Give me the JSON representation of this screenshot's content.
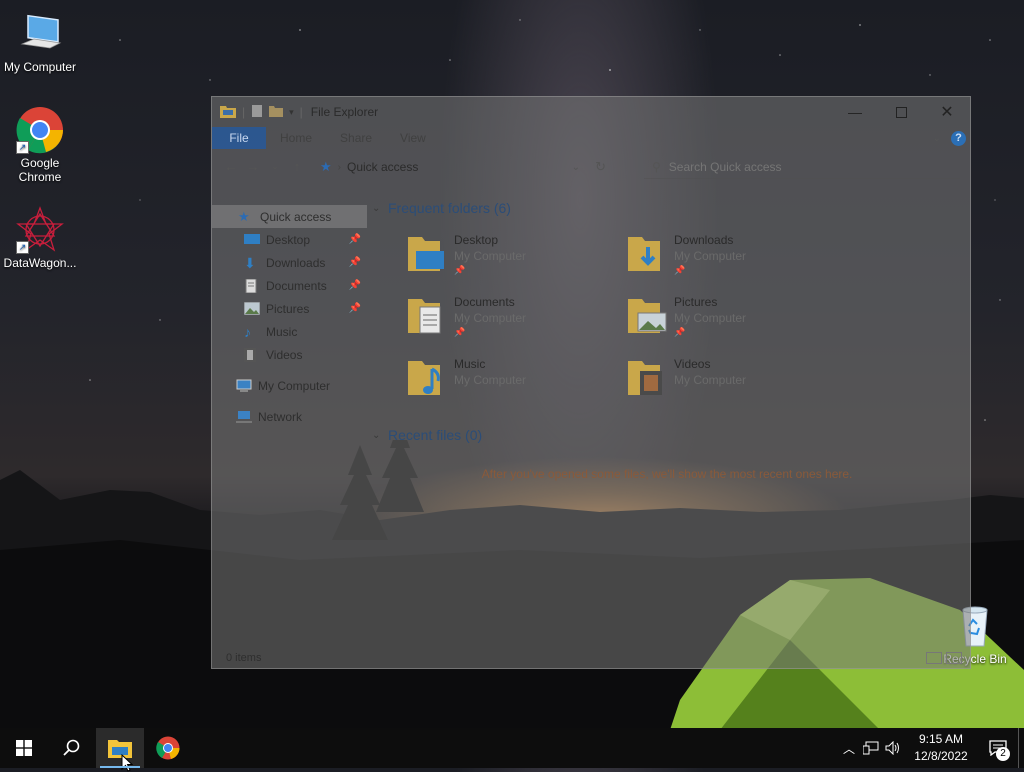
{
  "desktop": {
    "icons": [
      {
        "label": "My Computer"
      },
      {
        "label": "Google\nChrome"
      },
      {
        "label": "DataWagon..."
      },
      {
        "label": "Recycle Bin"
      }
    ]
  },
  "explorer": {
    "title": "File Explorer",
    "ribbon_tabs": [
      "File",
      "Home",
      "Share",
      "View"
    ],
    "address": "Quick access",
    "search_placeholder": "Search Quick access",
    "nav": [
      {
        "label": "Quick access",
        "icon": "star-icon"
      },
      {
        "label": "Desktop",
        "icon": "desktop-folder-icon",
        "pinned": true
      },
      {
        "label": "Downloads",
        "icon": "download-icon",
        "pinned": true
      },
      {
        "label": "Documents",
        "icon": "documents-icon",
        "pinned": true
      },
      {
        "label": "Pictures",
        "icon": "pictures-icon",
        "pinned": true
      },
      {
        "label": "Music",
        "icon": "music-icon"
      },
      {
        "label": "Videos",
        "icon": "videos-icon"
      },
      {
        "label": "My Computer",
        "icon": "computer-icon"
      },
      {
        "label": "Network",
        "icon": "network-icon"
      }
    ],
    "frequent_header": "Frequent folders (6)",
    "folders": [
      {
        "name": "Desktop",
        "location": "My Computer"
      },
      {
        "name": "Downloads",
        "location": "My Computer"
      },
      {
        "name": "Documents",
        "location": "My Computer"
      },
      {
        "name": "Pictures",
        "location": "My Computer"
      },
      {
        "name": "Music",
        "location": "My Computer"
      },
      {
        "name": "Videos",
        "location": "My Computer"
      }
    ],
    "recent_header": "Recent files (0)",
    "recent_empty": "After you've opened some files, we'll show the most recent ones here.",
    "status": "0 items"
  },
  "taskbar": {
    "time": "9:15 AM",
    "date": "12/8/2022",
    "notification_count": "2"
  },
  "colors": {
    "accent": "#0078d7",
    "taskbar": "#0d0d0d",
    "tent": "#9bd23c"
  }
}
